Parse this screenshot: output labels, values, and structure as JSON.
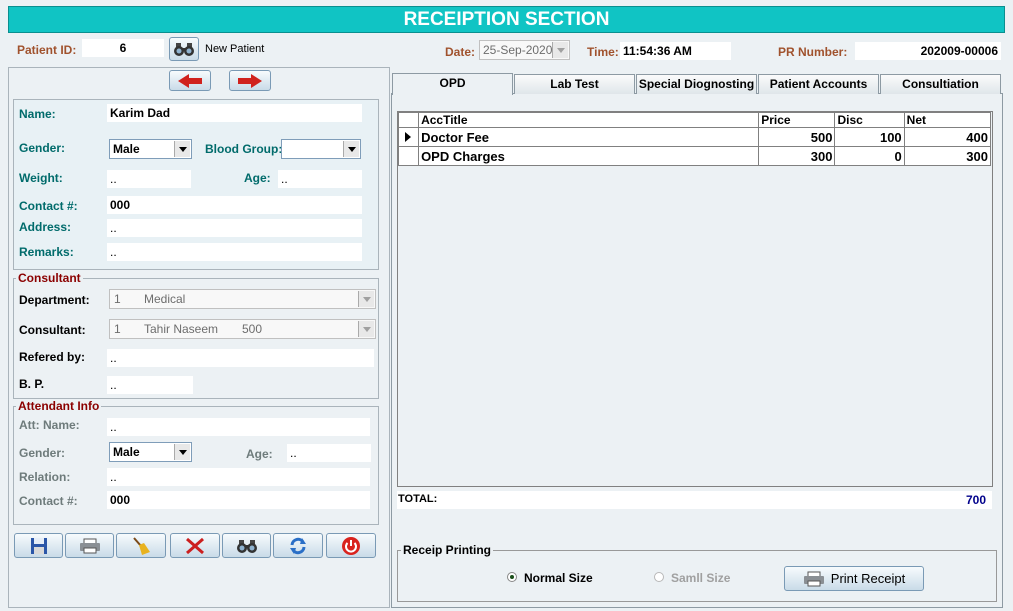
{
  "window": {
    "title": "RECEIPTION SECTION"
  },
  "header": {
    "patient_id_label": "Patient ID:",
    "patient_id_value": "6",
    "new_patient_label": "New Patient",
    "date_label": "Date:",
    "date_value": "25-Sep-2020",
    "time_label": "Time:",
    "time_value": "11:54:36 AM",
    "pr_number_label": "PR Number:",
    "pr_number_value": "202009-00006"
  },
  "patient": {
    "name_label": "Name:",
    "name_value": "Karim Dad",
    "gender_label": "Gender:",
    "gender_value": "Male",
    "blood_group_label": "Blood Group:",
    "blood_group_value": "",
    "weight_label": "Weight:",
    "weight_value": "..",
    "age_label": "Age:",
    "age_value": "..",
    "contact_label": "Contact #:",
    "contact_value": "000",
    "address_label": "Address:",
    "address_value": "..",
    "remarks_label": "Remarks:",
    "remarks_value": ".."
  },
  "consultant": {
    "group_title": "Consultant",
    "department_label": "Department:",
    "department_code": "1",
    "department_name": "Medical",
    "consultant_label": "Consultant:",
    "consultant_code": "1",
    "consultant_name": "Tahir Naseem",
    "consultant_fee": "500",
    "refered_by_label": "Refered by:",
    "refered_by_value": "..",
    "bp_label": "B. P.",
    "bp_value": ".."
  },
  "attendant": {
    "group_title": "Attendant Info",
    "name_label": "Att: Name:",
    "name_value": "..",
    "gender_label": "Gender:",
    "gender_value": "Male",
    "age_label": "Age:",
    "age_value": "..",
    "relation_label": "Relation:",
    "relation_value": "..",
    "contact_label": "Contact #:",
    "contact_value": "000"
  },
  "tabs": [
    {
      "label": "OPD"
    },
    {
      "label": "Lab Test"
    },
    {
      "label": "Special Diognosting"
    },
    {
      "label": "Patient Accounts"
    },
    {
      "label": "Consultiation"
    }
  ],
  "grid": {
    "columns": [
      "AccTitle",
      "Price",
      "Disc",
      "Net"
    ],
    "rows": [
      {
        "title": "Doctor Fee",
        "price": "500",
        "disc": "100",
        "net": "400"
      },
      {
        "title": "OPD Charges",
        "price": "300",
        "disc": "0",
        "net": "300"
      }
    ]
  },
  "total": {
    "label": "TOTAL:",
    "value": "700"
  },
  "printing": {
    "group_title": "Receip Printing",
    "normal_label": "Normal Size",
    "small_label": "Samll Size",
    "print_button": "Print Receipt"
  },
  "icons": {
    "prev": "left-arrow-icon",
    "next": "right-arrow-icon",
    "save": "floppy-disk-icon",
    "print": "printer-icon",
    "clear": "broom-icon",
    "delete": "red-x-icon",
    "search": "binoculars-icon",
    "refresh": "refresh-icon",
    "exit": "power-icon"
  },
  "colors": {
    "title_bar": "#10c4c4",
    "label_brown": "#a0522d",
    "label_teal": "#006b6b",
    "group_red": "#8b0000",
    "total_blue": "#00008b"
  }
}
